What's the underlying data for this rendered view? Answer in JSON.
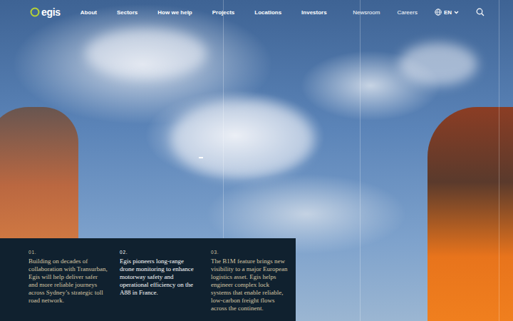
{
  "logo": {
    "text": "egis"
  },
  "nav": {
    "primary": [
      "About",
      "Sectors",
      "How we help",
      "Projects",
      "Locations",
      "Investors"
    ],
    "secondary": [
      "Newsroom",
      "Careers"
    ],
    "language": "EN"
  },
  "stories": [
    {
      "number": "01.",
      "text": "Building on decades of collaboration with Transurban, Egis will help deliver safer and more reliable journeys across Sydney’s strategic toll road network.",
      "selected": false
    },
    {
      "number": "02.",
      "text": "Egis pioneers long-range drone monitoring to enhance motorway safety and operational efficiency on the A88 in France.",
      "selected": true
    },
    {
      "number": "03.",
      "text": "The B1M feature brings new visibility to a major European logistics asset. Egis helps engineer complex lock systems that enable reliable, low-carbon freight flows across the continent.",
      "selected": false
    }
  ]
}
